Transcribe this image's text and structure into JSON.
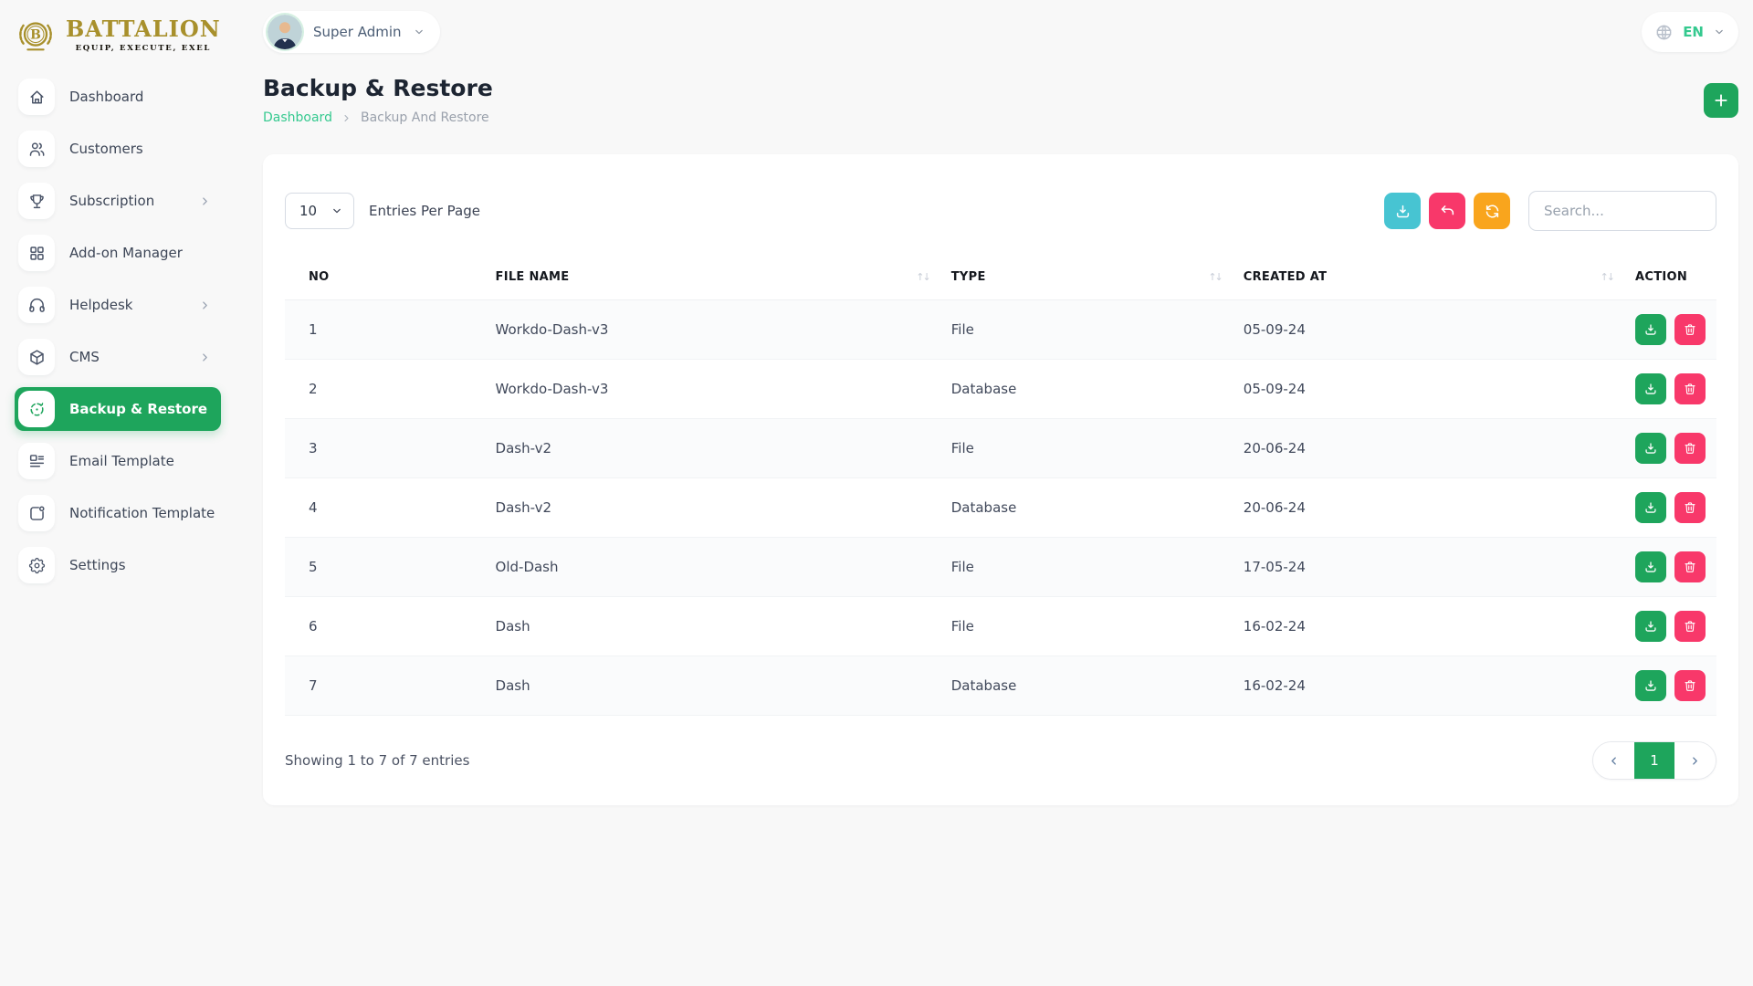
{
  "brand": {
    "name": "BATTALION",
    "tagline": "EQUIP, EXECUTE, EXEL"
  },
  "topbar": {
    "user_name": "Super Admin",
    "language": "EN"
  },
  "sidebar": {
    "items": [
      {
        "label": "Dashboard",
        "icon": "home-icon",
        "has_submenu": false,
        "active": false
      },
      {
        "label": "Customers",
        "icon": "users-icon",
        "has_submenu": false,
        "active": false
      },
      {
        "label": "Subscription",
        "icon": "trophy-icon",
        "has_submenu": true,
        "active": false
      },
      {
        "label": "Add-on Manager",
        "icon": "grid-icon",
        "has_submenu": false,
        "active": false
      },
      {
        "label": "Helpdesk",
        "icon": "headphones-icon",
        "has_submenu": true,
        "active": false
      },
      {
        "label": "CMS",
        "icon": "package-icon",
        "has_submenu": true,
        "active": false
      },
      {
        "label": "Backup & Restore",
        "icon": "backup-icon",
        "has_submenu": false,
        "active": true
      },
      {
        "label": "Email Template",
        "icon": "email-template-icon",
        "has_submenu": false,
        "active": false
      },
      {
        "label": "Notification Template",
        "icon": "notification-template-icon",
        "has_submenu": false,
        "active": false
      },
      {
        "label": "Settings",
        "icon": "gear-icon",
        "has_submenu": false,
        "active": false
      }
    ]
  },
  "page": {
    "title": "Backup & Restore",
    "breadcrumb_home": "Dashboard",
    "breadcrumb_current": "Backup And Restore"
  },
  "toolbar": {
    "entries_per_page": "10",
    "entries_per_page_label": "Entries Per Page",
    "search_placeholder": "Search..."
  },
  "table": {
    "columns": [
      "NO",
      "FILE NAME",
      "TYPE",
      "CREATED AT",
      "ACTION"
    ],
    "sort_glyph": "↑↓",
    "rows": [
      {
        "no": "1",
        "file_name": "Workdo-Dash-v3",
        "type": "File",
        "created_at": "05-09-24"
      },
      {
        "no": "2",
        "file_name": "Workdo-Dash-v3",
        "type": "Database",
        "created_at": "05-09-24"
      },
      {
        "no": "3",
        "file_name": "Dash-v2",
        "type": "File",
        "created_at": "20-06-24"
      },
      {
        "no": "4",
        "file_name": "Dash-v2",
        "type": "Database",
        "created_at": "20-06-24"
      },
      {
        "no": "5",
        "file_name": "Old-Dash",
        "type": "File",
        "created_at": "17-05-24"
      },
      {
        "no": "6",
        "file_name": "Dash",
        "type": "File",
        "created_at": "16-02-24"
      },
      {
        "no": "7",
        "file_name": "Dash",
        "type": "Database",
        "created_at": "16-02-24"
      }
    ]
  },
  "footer": {
    "showing_text": "Showing 1 to 7 of 7 entries",
    "current_page": "1"
  },
  "colors": {
    "primary_green": "#1ea55c",
    "mint": "#35c98f",
    "teal": "#47c4d2",
    "pink": "#f8386a",
    "orange": "#f9a51d",
    "gold": "#a8902c"
  }
}
